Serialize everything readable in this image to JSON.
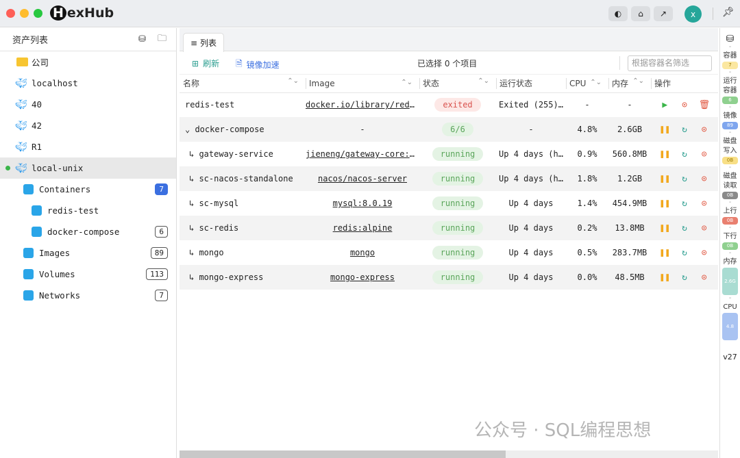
{
  "app": {
    "title": "HexHub",
    "avatar": "x"
  },
  "sidebar": {
    "title": "资产列表",
    "items": [
      {
        "label": "公司",
        "icon": "folder-icon"
      },
      {
        "label": "localhost",
        "icon": "docker-icon"
      },
      {
        "label": "40",
        "icon": "docker-icon"
      },
      {
        "label": "42",
        "icon": "docker-icon"
      },
      {
        "label": "R1",
        "icon": "docker-icon"
      },
      {
        "label": "local-unix",
        "icon": "docker-icon"
      }
    ],
    "children": [
      {
        "label": "Containers",
        "count": "7"
      },
      {
        "label": "redis-test",
        "count": ""
      },
      {
        "label": "docker-compose",
        "count": "6"
      },
      {
        "label": "Images",
        "count": "89"
      },
      {
        "label": "Volumes",
        "count": "113"
      },
      {
        "label": "Networks",
        "count": "7"
      }
    ]
  },
  "main": {
    "tab": "列表",
    "refresh": "刷新",
    "mirror": "镜像加速",
    "selected": "已选择 0 个项目",
    "filter_placeholder": "根据容器名筛选",
    "columns": [
      "名称",
      "Image",
      "状态",
      "运行状态",
      "CPU",
      "内存",
      "操作"
    ],
    "rows": [
      {
        "name": "redis-test",
        "image": "docker.io/library/redis",
        "status": "exited",
        "run": "Exited (255)…",
        "cpu": "-",
        "mem": "-",
        "type": "exited"
      },
      {
        "name": "docker-compose",
        "image": "-",
        "status": "6/6",
        "run": "-",
        "cpu": "4.8%",
        "mem": "2.6GB",
        "type": "group"
      },
      {
        "name": "gateway-service",
        "image": "jieneng/gateway-core:latest",
        "status": "running",
        "run": "Up 4 days (h…",
        "cpu": "0.9%",
        "mem": "560.8MB",
        "type": "child"
      },
      {
        "name": "sc-nacos-standalone",
        "image": "nacos/nacos-server",
        "status": "running",
        "run": "Up 4 days (h…",
        "cpu": "1.8%",
        "mem": "1.2GB",
        "type": "child"
      },
      {
        "name": "sc-mysql",
        "image": "mysql:8.0.19",
        "status": "running",
        "run": "Up 4 days",
        "cpu": "1.4%",
        "mem": "454.9MB",
        "type": "child"
      },
      {
        "name": "sc-redis",
        "image": "redis:alpine",
        "status": "running",
        "run": "Up 4 days",
        "cpu": "0.2%",
        "mem": "13.8MB",
        "type": "child"
      },
      {
        "name": "mongo",
        "image": "mongo",
        "status": "running",
        "run": "Up 4 days",
        "cpu": "0.5%",
        "mem": "283.7MB",
        "type": "child"
      },
      {
        "name": "mongo-express",
        "image": "mongo-express",
        "status": "running",
        "run": "Up 4 days",
        "cpu": "0.0%",
        "mem": "48.5MB",
        "type": "child"
      }
    ]
  },
  "stats": [
    {
      "label": "容器",
      "value": "7",
      "color": "#fbe7a0"
    },
    {
      "label": "运行容器",
      "value": "6",
      "color": "#8fd08f"
    },
    {
      "label": "镜像",
      "value": "89",
      "color": "#7fa6ee"
    },
    {
      "label": "磁盘写入",
      "value": "0B",
      "color": "#f8df86"
    },
    {
      "label": "磁盘读取",
      "value": "0B",
      "color": "#8a8a8a"
    },
    {
      "label": "上行",
      "value": "0B",
      "color": "#e98070"
    },
    {
      "label": "下行",
      "value": "0B",
      "color": "#8fd08f"
    },
    {
      "label": "内存",
      "value": "2.6G",
      "color": "#a9dcd2"
    },
    {
      "label": "CPU",
      "value": "4.8",
      "color": "#a9c3f2"
    }
  ],
  "version": "v27",
  "watermark": "公众号 · SQL编程思想"
}
